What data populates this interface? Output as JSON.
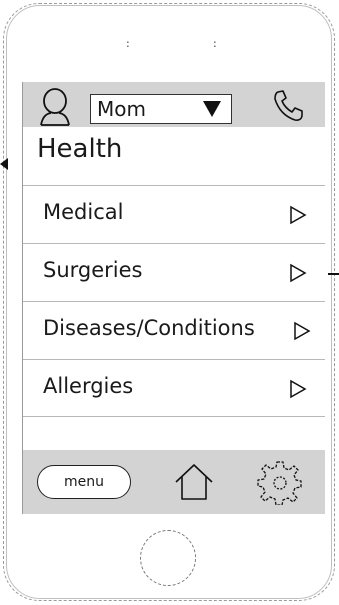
{
  "header": {
    "profile_selected": "Mom"
  },
  "page": {
    "title": "Health"
  },
  "menu_items": [
    {
      "label": "Medical"
    },
    {
      "label": "Surgeries"
    },
    {
      "label": "Diseases/Conditions"
    },
    {
      "label": "Allergies"
    }
  ],
  "footer": {
    "menu_label": "menu"
  },
  "device": {
    "earpiece_left": ":",
    "earpiece_right": ":"
  }
}
